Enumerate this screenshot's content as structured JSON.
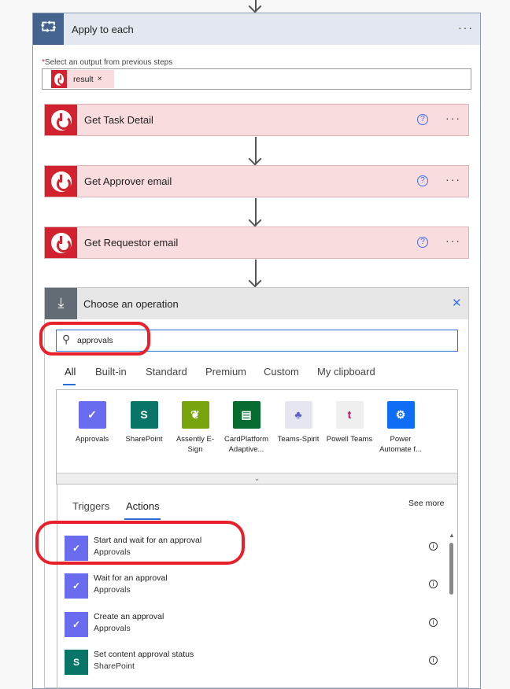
{
  "loop": {
    "title": "Apply to each",
    "field_label": "Select an output from previous steps",
    "required_mark": "*",
    "token": "result",
    "token_remove": "×",
    "more": "···"
  },
  "steps": [
    {
      "label": "Get Task Detail"
    },
    {
      "label": "Get Approver email"
    },
    {
      "label": "Get Requestor email"
    }
  ],
  "help_glyph": "?",
  "chooser": {
    "title": "Choose an operation",
    "close": "✕",
    "search_value": "approvals",
    "tabs": [
      "All",
      "Built-in",
      "Standard",
      "Premium",
      "Custom",
      "My clipboard"
    ],
    "active_tab": "All",
    "connectors": [
      {
        "name": "Approvals",
        "color": "#6a6cf0",
        "glyph": "✓"
      },
      {
        "name": "SharePoint",
        "color": "#077568",
        "glyph": "S"
      },
      {
        "name": "Assently E-Sign",
        "color": "#78a50e",
        "glyph": "❦"
      },
      {
        "name": "CardPlatform Adaptive...",
        "color": "#056b2f",
        "glyph": "▤"
      },
      {
        "name": "Teams-Spirit",
        "color": "#e6e6f0",
        "glyph": "♣"
      },
      {
        "name": "Powell Teams",
        "color": "#efefef",
        "glyph": "t"
      },
      {
        "name": "Power Automate f...",
        "color": "#0f6cf5",
        "glyph": "⚙"
      }
    ],
    "subtabs": [
      "Triggers",
      "Actions"
    ],
    "active_subtab": "Actions",
    "see_more": "See more",
    "actions": [
      {
        "title": "Start and wait for an approval",
        "connector": "Approvals",
        "color": "#6a6cf0",
        "glyph": "✓"
      },
      {
        "title": "Wait for an approval",
        "connector": "Approvals",
        "color": "#6a6cf0",
        "glyph": "✓"
      },
      {
        "title": "Create an approval",
        "connector": "Approvals",
        "color": "#6a6cf0",
        "glyph": "✓"
      },
      {
        "title": "Set content approval status",
        "connector": "SharePoint",
        "color": "#077568",
        "glyph": "S"
      }
    ],
    "info_glyph": "i"
  }
}
